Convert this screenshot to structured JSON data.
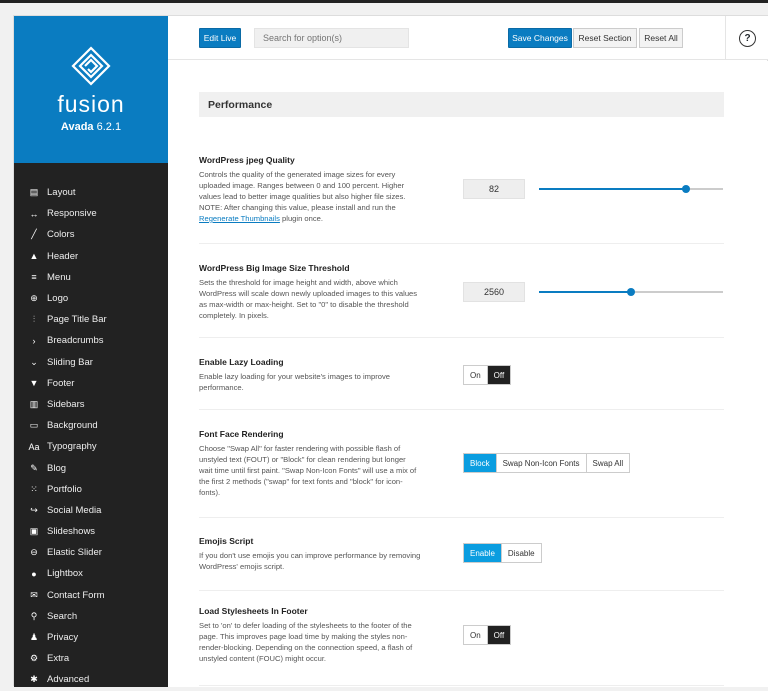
{
  "brand": {
    "logo_text": "fusion",
    "product": "Avada",
    "version": "6.2.1",
    "color": "#0a7cc1"
  },
  "sidebar": {
    "items": [
      {
        "label": "Layout",
        "icon": "layout-icon",
        "glyph": "▤"
      },
      {
        "label": "Responsive",
        "icon": "responsive-icon",
        "glyph": "↔"
      },
      {
        "label": "Colors",
        "icon": "colors-icon",
        "glyph": "╱"
      },
      {
        "label": "Header",
        "icon": "header-icon",
        "glyph": "▲"
      },
      {
        "label": "Menu",
        "icon": "menu-icon",
        "glyph": "≡"
      },
      {
        "label": "Logo",
        "icon": "logo-icon",
        "glyph": "⊕"
      },
      {
        "label": "Page Title Bar",
        "icon": "page-title-bar-icon",
        "glyph": "⫶"
      },
      {
        "label": "Breadcrumbs",
        "icon": "breadcrumbs-icon",
        "glyph": "›"
      },
      {
        "label": "Sliding Bar",
        "icon": "sliding-bar-icon",
        "glyph": "⌄"
      },
      {
        "label": "Footer",
        "icon": "footer-icon",
        "glyph": "▼"
      },
      {
        "label": "Sidebars",
        "icon": "sidebars-icon",
        "glyph": "▥"
      },
      {
        "label": "Background",
        "icon": "background-icon",
        "glyph": "▭"
      },
      {
        "label": "Typography",
        "icon": "typography-icon",
        "glyph": "Aa"
      },
      {
        "label": "Blog",
        "icon": "blog-icon",
        "glyph": "✎"
      },
      {
        "label": "Portfolio",
        "icon": "portfolio-icon",
        "glyph": "⁙"
      },
      {
        "label": "Social Media",
        "icon": "social-media-icon",
        "glyph": "↪"
      },
      {
        "label": "Slideshows",
        "icon": "slideshows-icon",
        "glyph": "▣"
      },
      {
        "label": "Elastic Slider",
        "icon": "elastic-slider-icon",
        "glyph": "⊖"
      },
      {
        "label": "Lightbox",
        "icon": "lightbox-icon",
        "glyph": "●"
      },
      {
        "label": "Contact Form",
        "icon": "contact-form-icon",
        "glyph": "✉"
      },
      {
        "label": "Search",
        "icon": "search-icon",
        "glyph": "⚲"
      },
      {
        "label": "Privacy",
        "icon": "privacy-icon",
        "glyph": "♟"
      },
      {
        "label": "Extra",
        "icon": "extra-icon",
        "glyph": "⚙"
      },
      {
        "label": "Advanced",
        "icon": "advanced-icon",
        "glyph": "✱"
      }
    ]
  },
  "header": {
    "edit_live": "Edit Live",
    "search_placeholder": "Search for option(s)",
    "save": "Save Changes",
    "reset_section": "Reset Section",
    "reset_all": "Reset All",
    "help": "?"
  },
  "section": {
    "title": "Performance"
  },
  "options": {
    "jpeg": {
      "title": "WordPress jpeg Quality",
      "desc": "Controls the quality of the generated image sizes for every uploaded image. Ranges between 0 and 100 percent. Higher values lead to better image qualities but also higher file sizes. NOTE: After changing this value, please install and run the ",
      "link": "Regenerate Thumbnails",
      "desc_tail": " plugin once.",
      "value": "82",
      "slider_fraction": 0.8
    },
    "bigimage": {
      "title": "WordPress Big Image Size Threshold",
      "desc": "Sets the threshold for image height and width, above which WordPress will scale down newly uploaded images to this values as max-width or max-height. Set to \"0\" to disable the threshold completely. In pixels.",
      "value": "2560",
      "slider_fraction": 0.5
    },
    "lazy": {
      "title": "Enable Lazy Loading",
      "desc": "Enable lazy loading for your website's images to improve performance.",
      "on": "On",
      "off": "Off",
      "selected": "off"
    },
    "font": {
      "title": "Font Face Rendering",
      "desc": "Choose \"Swap All\" for faster rendering with possible flash of unstyled text (FOUT) or \"Block\" for clean rendering but longer wait time until first paint. \"Swap Non-Icon Fonts\" will use a mix of the first 2 methods (\"swap\" for text fonts and \"block\" for icon-fonts).",
      "block": "Block",
      "swap_non_icon": "Swap Non-Icon Fonts",
      "swap_all": "Swap All",
      "selected": "block"
    },
    "emoji": {
      "title": "Emojis Script",
      "desc": "If you don't use emojis you can improve performance by removing WordPress' emojis script.",
      "enable": "Enable",
      "disable": "Disable",
      "selected": "enable"
    },
    "footer_css": {
      "title": "Load Stylesheets In Footer",
      "desc": "Set to 'on' to defer loading of the stylesheets to the footer of the page. This improves page load time by making the styles non-render-blocking. Depending on the connection speed, a flash of unstyled content (FOUC) might occur.",
      "on": "On",
      "off": "Off",
      "selected": "off"
    }
  }
}
